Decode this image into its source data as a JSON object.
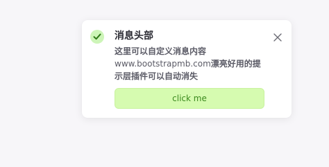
{
  "toast": {
    "title": "消息头部",
    "body_line1": "这里可以自定义消息内容",
    "body_url": "www.bootstrapmb.com",
    "body_after_url": "漂亮好用的提",
    "body_line3": "示层插件可以自动消失",
    "button_label": "click me",
    "icon": "check-icon",
    "close_icon": "close-icon"
  },
  "colors": {
    "accent_green": "#cdf5b8",
    "button_bg": "#d6fbb0",
    "button_text": "#3b8a1e"
  }
}
